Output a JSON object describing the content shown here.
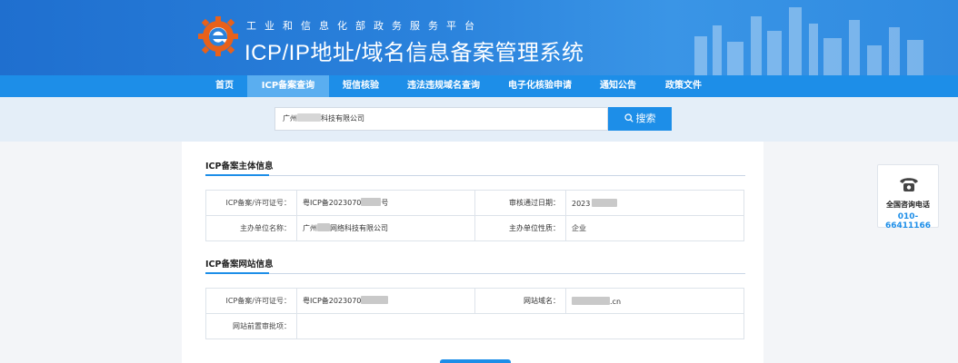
{
  "header": {
    "subtitle": "工业和信息化部政务服务平台",
    "title": "ICP/IP地址/域名信息备案管理系统"
  },
  "nav": {
    "items": [
      {
        "label": "首页"
      },
      {
        "label": "ICP备案查询"
      },
      {
        "label": "短信核验"
      },
      {
        "label": "违法违规域名查询"
      },
      {
        "label": "电子化核验申请"
      },
      {
        "label": "通知公告"
      },
      {
        "label": "政策文件"
      }
    ],
    "active_index": 1
  },
  "search": {
    "value": "广州████科技有限公司",
    "value_prefix": "广州",
    "value_suffix": "科技有限公司",
    "button_label": "搜索"
  },
  "subject_section": {
    "title": "ICP备案主体信息",
    "rows": [
      {
        "label1": "ICP备案/许可证号：",
        "value1_prefix": "粤ICP备2023070",
        "value1_suffix": "号",
        "label2": "审核通过日期：",
        "value2_prefix": "2023",
        "value2_suffix": ""
      },
      {
        "label1": "主办单位名称：",
        "value1_prefix": "广州",
        "value1_suffix": "网络科技有限公司",
        "label2": "主办单位性质：",
        "value2_prefix": "企业",
        "value2_suffix": ""
      }
    ]
  },
  "website_section": {
    "title": "ICP备案网站信息",
    "rows": [
      {
        "label1": "ICP备案/许可证号：",
        "value1_prefix": "粤ICP备2023070",
        "value1_suffix": "",
        "label2": "网站域名：",
        "value2_prefix": "",
        "value2_suffix": ".cn"
      },
      {
        "label1": "网站前置审批项：",
        "value1_prefix": "",
        "value1_suffix": ""
      }
    ]
  },
  "contact": {
    "label": "全国咨询电话",
    "phone": "010-66411166"
  },
  "colors": {
    "brand_blue": "#1d8ee8",
    "header_blue": "#2a82dc",
    "nav_active": "#5aaef0"
  }
}
